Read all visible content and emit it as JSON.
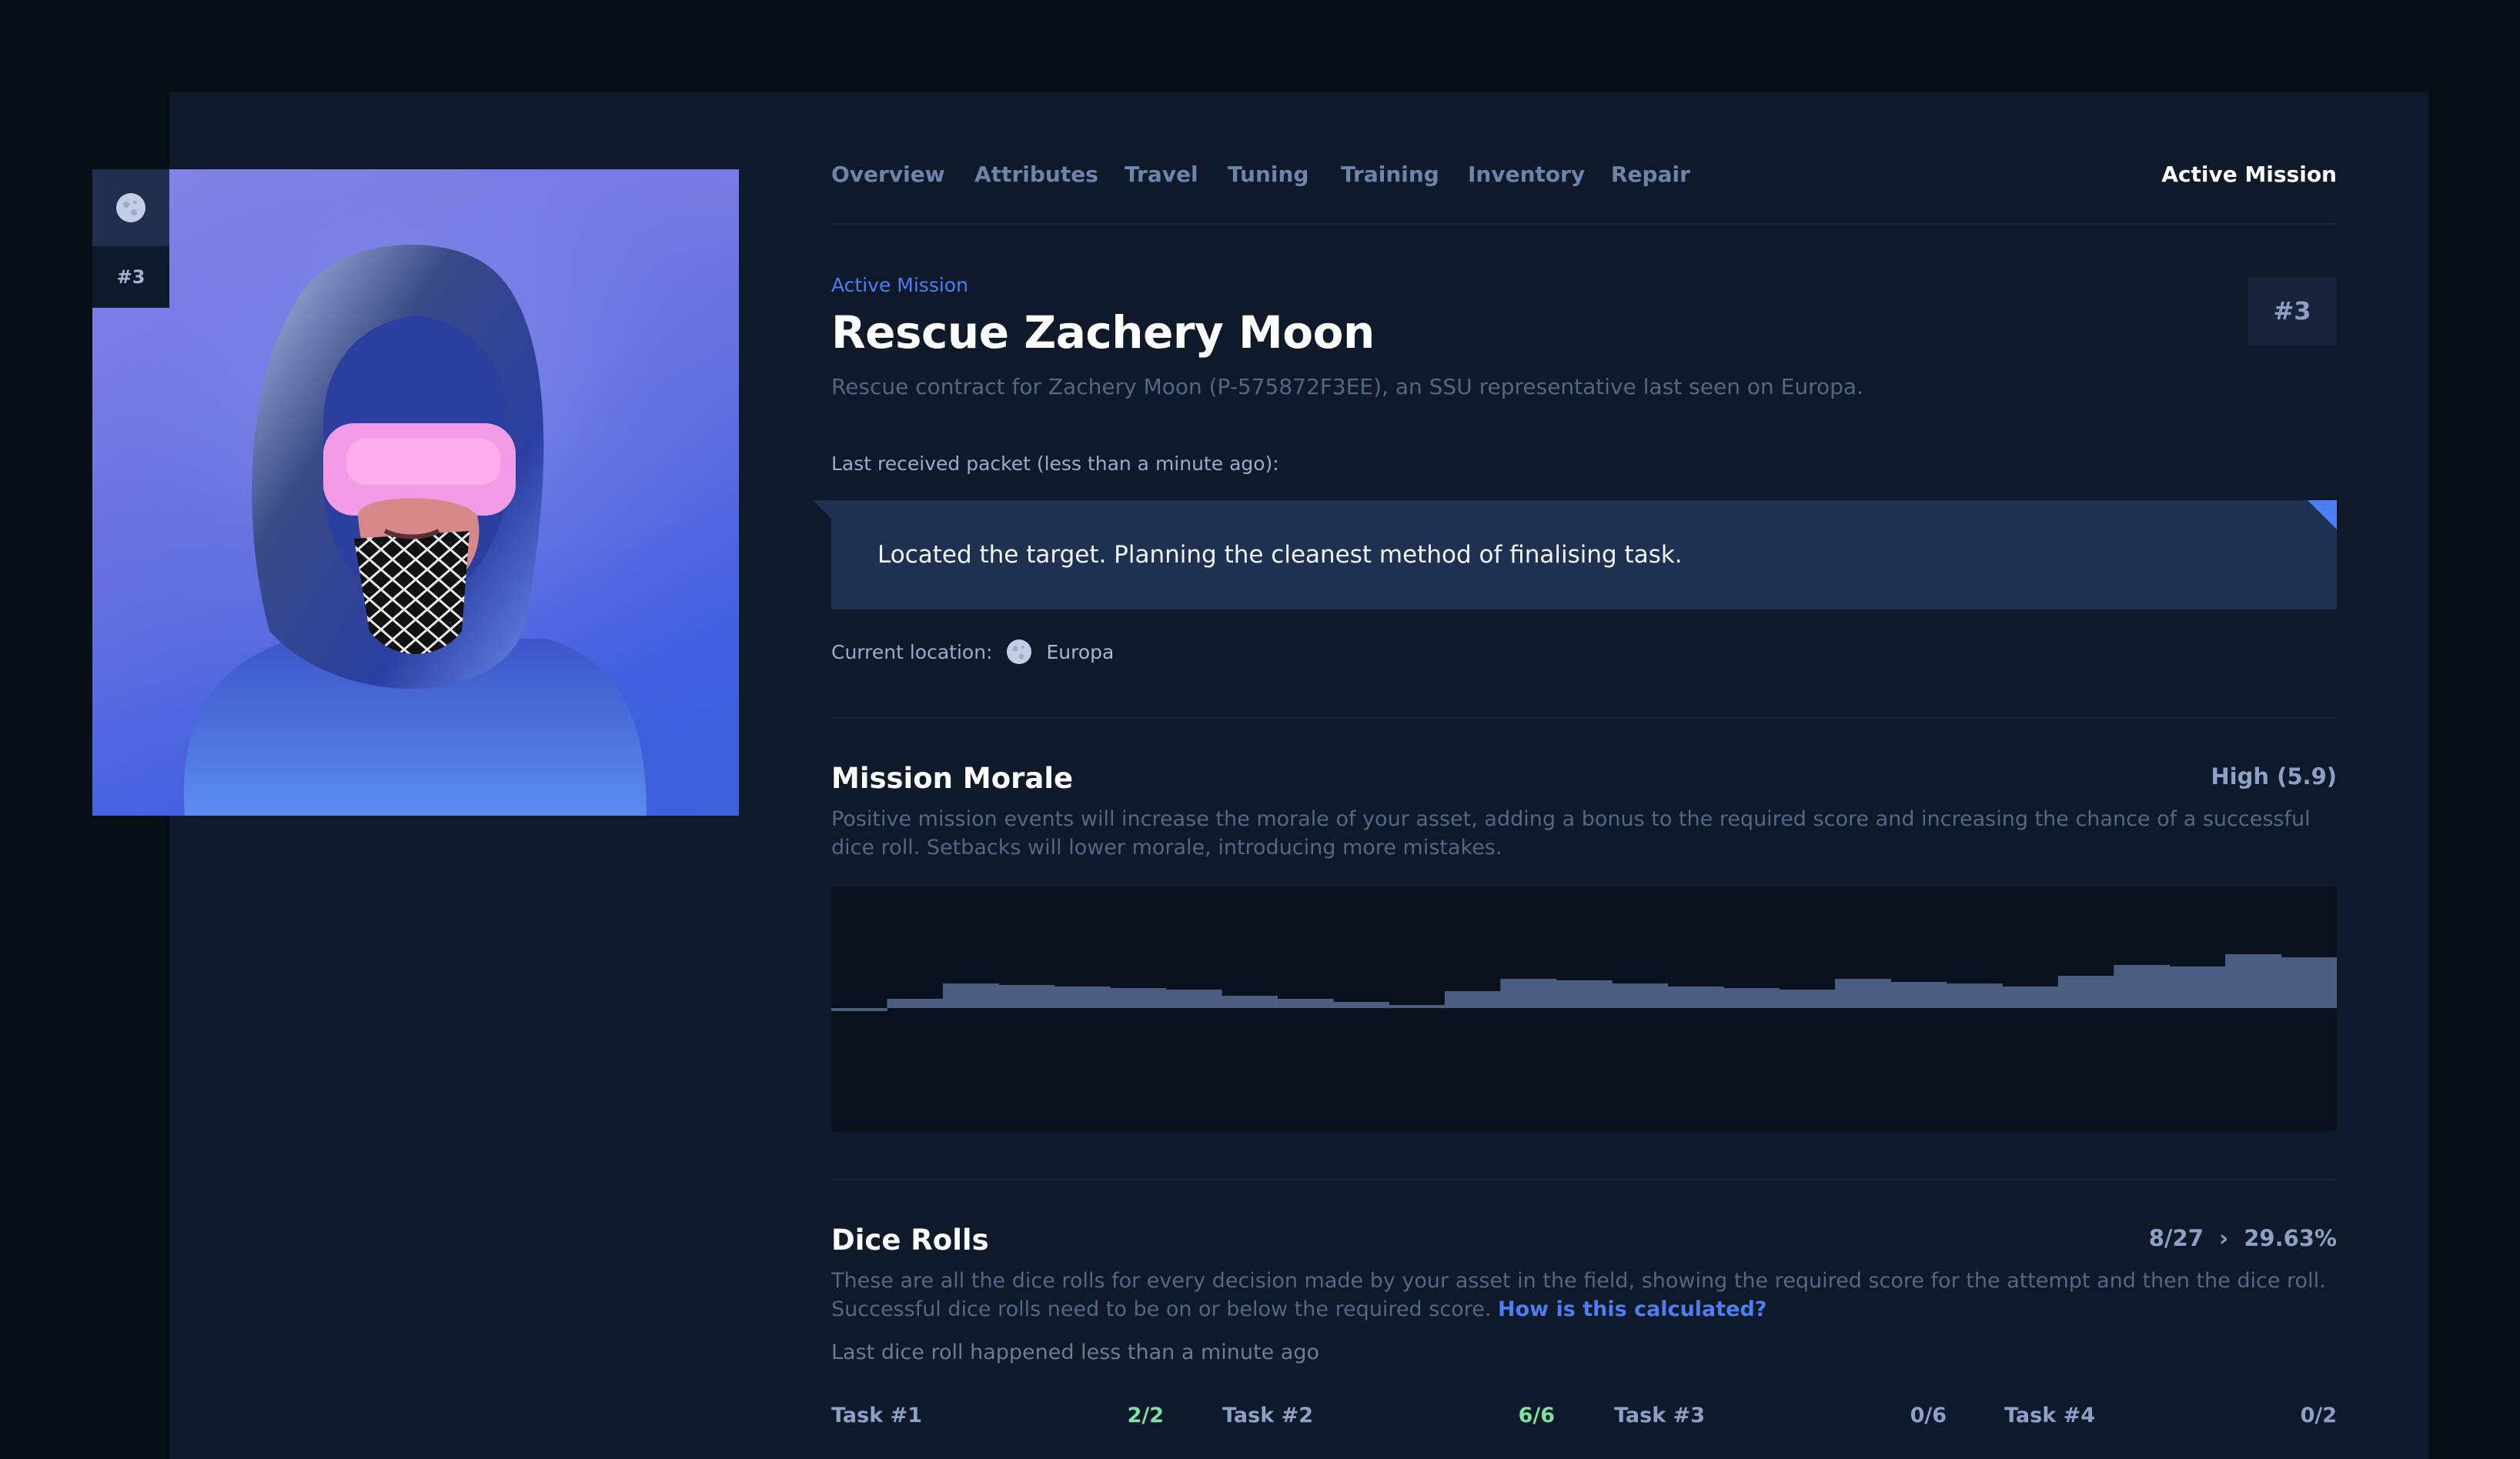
{
  "asset": {
    "number": "#3"
  },
  "nav": {
    "tabs": [
      "Overview",
      "Attributes",
      "Travel",
      "Tuning",
      "Training",
      "Inventory",
      "Repair"
    ],
    "active": "Active Mission"
  },
  "mission": {
    "eyebrow": "Active Mission",
    "title": "Rescue Zachery Moon",
    "subtitle": "Rescue contract for Zachery Moon (P-575872F3EE), an SSU representative last seen on Europa.",
    "badge": "#3",
    "packet_label": "Last received packet (less than a minute ago):",
    "packet_text": "Located the target. Planning the cleanest method of finalising task.",
    "location_label": "Current location:",
    "location": "Europa"
  },
  "morale": {
    "title": "Mission Morale",
    "value": "High (5.9)",
    "description": "Positive mission events will increase the morale of your asset, adding a bonus to the required score and increasing the chance of a successful dice roll. Setbacks will lower morale, introducing more mistakes."
  },
  "dice": {
    "title": "Dice Rolls",
    "value": "8/27  ›  29.63%",
    "description": "These are all the dice rolls for every decision made by your asset in the field, showing the required score for the attempt and then the dice roll. Successful dice rolls need to be on or below the required score.",
    "link": "How is this calculated?",
    "last_roll": "Last dice roll happened less than a minute ago"
  },
  "tasks": [
    {
      "label": "Task #1",
      "count": "2/2"
    },
    {
      "label": "Task #2",
      "count": "6/6"
    },
    {
      "label": "Task #3",
      "count": "0/6"
    },
    {
      "label": "Task #4",
      "count": "0/2"
    }
  ],
  "colors": {
    "background": "#070d15",
    "panel": "#0e1929",
    "accent": "#4f7df2",
    "success": "#7be3a1",
    "chart_fill": "#4b5d80"
  },
  "chart_data": {
    "type": "area",
    "x": [
      1,
      2,
      3,
      4,
      5,
      6,
      7,
      8,
      9,
      10,
      11,
      12,
      13,
      14,
      15,
      16,
      17,
      18,
      19,
      20,
      21,
      22,
      23,
      24,
      25,
      26,
      27
    ],
    "values": [
      -0.2,
      0.6,
      1.6,
      1.5,
      1.4,
      1.3,
      1.2,
      0.8,
      0.6,
      0.4,
      0.2,
      1.1,
      1.9,
      1.8,
      1.6,
      1.4,
      1.3,
      1.2,
      1.9,
      1.7,
      1.6,
      1.4,
      2.1,
      2.8,
      2.7,
      3.5,
      3.3
    ]
  }
}
